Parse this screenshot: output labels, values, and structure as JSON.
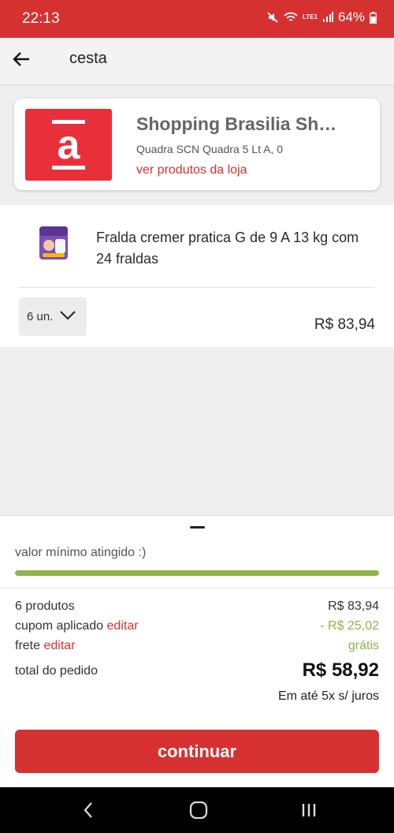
{
  "status_bar": {
    "time": "22:13",
    "battery": "64%",
    "network": "LTE1"
  },
  "header": {
    "title": "cesta"
  },
  "store": {
    "logo_letter": "a",
    "name": "Shopping Brasilia Sh…",
    "address": "Quadra SCN Quadra 5 Lt A, 0",
    "link": "ver produtos da loja"
  },
  "product": {
    "name": "Fralda cremer pratica G de 9 A 13 kg com 24 fraldas",
    "quantity": "6 un.",
    "price": "R$ 83,94"
  },
  "summary": {
    "min_label": "valor mínimo atingido :)",
    "progress": 1.0,
    "products_label": "6 produtos",
    "products_value": "R$ 83,94",
    "coupon_label": "cupom aplicado",
    "coupon_edit": "editar",
    "coupon_value": "- R$ 25,02",
    "shipping_label": "frete",
    "shipping_edit": "editar",
    "shipping_value": "grátis",
    "total_label": "total do pedido",
    "total_value": "R$ 58,92",
    "installments": "Em até 5x s/ juros",
    "continue_label": "continuar"
  },
  "colors": {
    "brand": "#d63131",
    "logo": "#e8303b",
    "success": "#8fb44a"
  }
}
